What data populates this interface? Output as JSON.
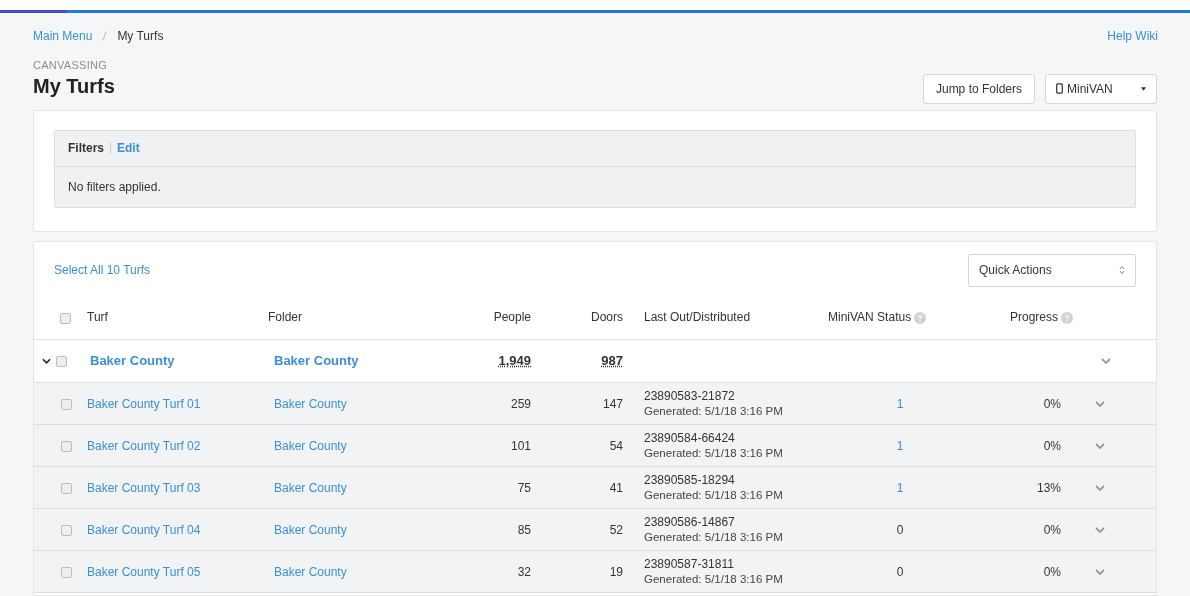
{
  "breadcrumb": [
    {
      "label": "Main Menu",
      "link": true
    },
    {
      "label": "My Turfs",
      "link": false
    }
  ],
  "help_link": "Help Wiki",
  "section": "CANVASSING",
  "title": "My Turfs",
  "buttons": [
    "Jump to Folders"
  ],
  "minivan_menu": {
    "label": "MiniVAN"
  },
  "filters": {
    "title": "Filters",
    "edit": "Edit",
    "message": "No filters applied."
  },
  "select_all": "Select All 10 Turfs",
  "quick_actions": "Quick Actions",
  "columns": [
    "Turf",
    "Folder",
    "People",
    "Doors",
    "Last Out/Distributed",
    "MiniVAN Status",
    "Progress"
  ],
  "header_checked": false,
  "group": {
    "turf": "Baker County",
    "folder": "Baker County",
    "people": "1,949",
    "doors": "987",
    "expanded": true,
    "checked": false
  },
  "rows": [
    {
      "turf": "Baker County Turf 01",
      "folder": "Baker County",
      "people": "259",
      "doors": "147",
      "list_id": "23890583-21872",
      "generated": "Generated: 5/1/18 3:16 PM",
      "status": "1",
      "status_link": true,
      "progress": "0%",
      "checked": false
    },
    {
      "turf": "Baker County Turf 02",
      "folder": "Baker County",
      "people": "101",
      "doors": "54",
      "list_id": "23890584-66424",
      "generated": "Generated: 5/1/18 3:16 PM",
      "status": "1",
      "status_link": true,
      "progress": "0%",
      "checked": false
    },
    {
      "turf": "Baker County Turf 03",
      "folder": "Baker County",
      "people": "75",
      "doors": "41",
      "list_id": "23890585-18294",
      "generated": "Generated: 5/1/18 3:16 PM",
      "status": "1",
      "status_link": true,
      "progress": "13%",
      "checked": false
    },
    {
      "turf": "Baker County Turf 04",
      "folder": "Baker County",
      "people": "85",
      "doors": "52",
      "list_id": "23890586-14867",
      "generated": "Generated: 5/1/18 3:16 PM",
      "status": "0",
      "status_link": false,
      "progress": "0%",
      "checked": false
    },
    {
      "turf": "Baker County Turf 05",
      "folder": "Baker County",
      "people": "32",
      "doors": "19",
      "list_id": "23890587-31811",
      "generated": "Generated: 5/1/18 3:16 PM",
      "status": "0",
      "status_link": false,
      "progress": "0%",
      "checked": false
    }
  ]
}
